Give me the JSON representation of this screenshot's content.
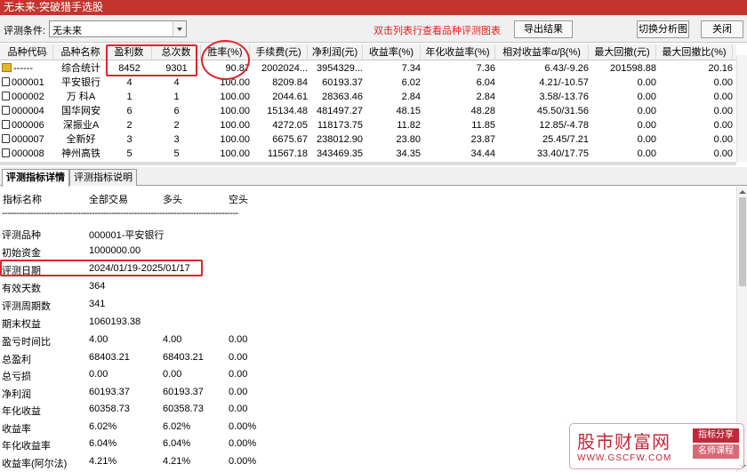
{
  "window": {
    "title": "无未来-突破猎手选股"
  },
  "toolbar": {
    "condition_label": "评测条件:",
    "condition_value": "无未来",
    "hint": "双击列表行查看品种评测图表",
    "export_label": "导出结果",
    "switch_label": "切换分析图",
    "close_label": "关闭"
  },
  "table": {
    "columns": [
      "品种代码",
      "品种名称",
      "盈利数",
      "总次数",
      "胜率(%)",
      "手续费(元)",
      "净利润(元)",
      "收益率(%)",
      "年化收益率(%)",
      "相对收益率α/β(%)",
      "最大回撤(元)",
      "最大回撤比(%)"
    ],
    "rows": [
      {
        "icon": "flag-icon",
        "code": "------",
        "name": "综合统计",
        "wins": "8452",
        "total": "9301",
        "win_rate": "90.87",
        "fee": "2002024...",
        "net_profit": "3954329...",
        "return": "7.34",
        "annual_return": "7.36",
        "alpha_beta": "6.43/-9.26",
        "max_dd": "201598.88",
        "max_dd_ratio": "20.16"
      },
      {
        "icon": "stock-icon",
        "code": "000001",
        "name": "平安银行",
        "wins": "4",
        "total": "4",
        "win_rate": "100.00",
        "fee": "8209.84",
        "net_profit": "60193.37",
        "return": "6.02",
        "annual_return": "6.04",
        "alpha_beta": "4.21/-10.57",
        "max_dd": "0.00",
        "max_dd_ratio": "0.00"
      },
      {
        "icon": "stock-icon",
        "code": "000002",
        "name": "万 科A",
        "wins": "1",
        "total": "1",
        "win_rate": "100.00",
        "fee": "2044.61",
        "net_profit": "28363.46",
        "return": "2.84",
        "annual_return": "2.84",
        "alpha_beta": "3.58/-13.76",
        "max_dd": "0.00",
        "max_dd_ratio": "0.00"
      },
      {
        "icon": "stock-icon",
        "code": "000004",
        "name": "国华网安",
        "wins": "6",
        "total": "6",
        "win_rate": "100.00",
        "fee": "15134.48",
        "net_profit": "481497.27",
        "return": "48.15",
        "annual_return": "48.28",
        "alpha_beta": "45.50/31.56",
        "max_dd": "0.00",
        "max_dd_ratio": "0.00"
      },
      {
        "icon": "stock-icon",
        "code": "000006",
        "name": "深振业A",
        "wins": "2",
        "total": "2",
        "win_rate": "100.00",
        "fee": "4272.05",
        "net_profit": "118173.75",
        "return": "11.82",
        "annual_return": "11.85",
        "alpha_beta": "12.85/-4.78",
        "max_dd": "0.00",
        "max_dd_ratio": "0.00"
      },
      {
        "icon": "stock-icon",
        "code": "000007",
        "name": "全新好",
        "wins": "3",
        "total": "3",
        "win_rate": "100.00",
        "fee": "6675.67",
        "net_profit": "238012.90",
        "return": "23.80",
        "annual_return": "23.87",
        "alpha_beta": "25.45/7.21",
        "max_dd": "0.00",
        "max_dd_ratio": "0.00"
      },
      {
        "icon": "stock-icon",
        "code": "000008",
        "name": "神州高铁",
        "wins": "5",
        "total": "5",
        "win_rate": "100.00",
        "fee": "11567.18",
        "net_profit": "343469.35",
        "return": "34.35",
        "annual_return": "34.44",
        "alpha_beta": "33.40/17.75",
        "max_dd": "0.00",
        "max_dd_ratio": "0.00"
      }
    ]
  },
  "tabs": [
    "评测指标详情",
    "评测指标说明"
  ],
  "detail": {
    "header": [
      "指标名称",
      "全部交易",
      "多头",
      "空头"
    ],
    "divider": "------------------------------------------------------------------------------------",
    "info": [
      {
        "label": "评测品种",
        "value": "000001-平安银行"
      },
      {
        "label": "初始资金",
        "value": "1000000.00"
      },
      {
        "label": "评测日期",
        "value": "2024/01/19-2025/01/17"
      },
      {
        "label": "有效天数",
        "value": "364"
      },
      {
        "label": "评测周期数",
        "value": "341"
      },
      {
        "label": "期末权益",
        "value": "1060193.38"
      }
    ],
    "metrics": [
      {
        "label": "盈亏时间比",
        "all": "4.00",
        "long": "4.00",
        "short": "0.00"
      },
      {
        "label": "总盈利",
        "all": "68403.21",
        "long": "68403.21",
        "short": "0.00"
      },
      {
        "label": "总亏损",
        "all": "0.00",
        "long": "0.00",
        "short": "0.00"
      },
      {
        "label": "净利润",
        "all": "60193.37",
        "long": "60193.37",
        "short": "0.00"
      },
      {
        "label": "年化收益",
        "all": "60358.73",
        "long": "60358.73",
        "short": "0.00"
      },
      {
        "label": "收益率",
        "all": "6.02%",
        "long": "6.02%",
        "short": "0.00%"
      },
      {
        "label": "年化收益率",
        "all": "6.04%",
        "long": "6.04%",
        "short": "0.00%"
      },
      {
        "label": "收益率(阿尔法)",
        "all": "4.21%",
        "long": "4.21%",
        "short": "0.00%"
      }
    ]
  },
  "watermark": {
    "name": "股市财富网",
    "tag1": "指标分享",
    "tag2": "名师课程",
    "url": "WWW.GSCFW.COM"
  },
  "colors": {
    "titlebar": "#c4342f",
    "hint": "#e02020",
    "highlight": "#e0242c"
  }
}
